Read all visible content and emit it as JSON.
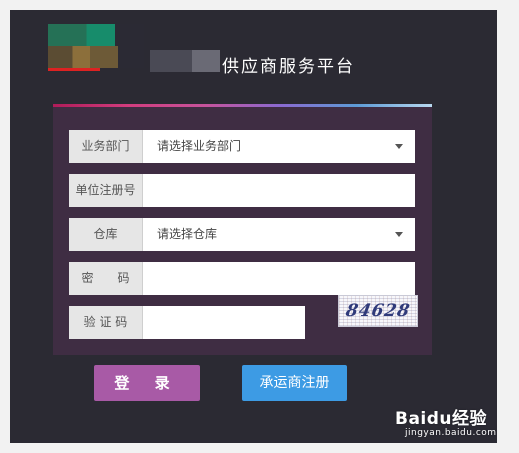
{
  "header": {
    "title": "供应商服务平台"
  },
  "form": {
    "department": {
      "label": "业务部门",
      "value": "请选择业务部门"
    },
    "unit_reg_no": {
      "label": "单位注册号",
      "value": ""
    },
    "warehouse": {
      "label": "仓库",
      "value": "请选择仓库"
    },
    "password": {
      "label": "密　　码",
      "value": ""
    },
    "captcha": {
      "label": "验 证 码",
      "value": "",
      "image_text": "84628"
    }
  },
  "actions": {
    "login_label": "登 录",
    "register_label": "承运商注册"
  },
  "watermark": {
    "brand": "Baidu经验",
    "url": "jingyan.baidu.com"
  },
  "colors": {
    "panel_bg": "#2b2a33",
    "form_bg": "#3f2d43",
    "login_btn": "#a85aa6",
    "register_btn": "#3d9be4"
  }
}
